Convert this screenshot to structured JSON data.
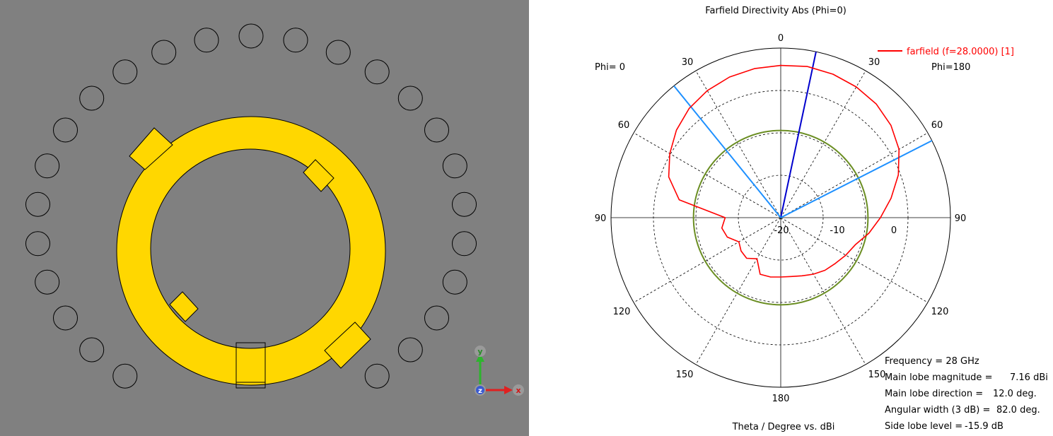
{
  "colors": {
    "viewport_bg": "#808080",
    "ring_fill": "#ffd700",
    "via_stroke": "#000000",
    "curve": "#ff0000",
    "reference_circle": "#6b8e23",
    "main_lobe": "#0000cd",
    "beamwidth": "#1e90ff"
  },
  "axes_widget": {
    "y_label": "y",
    "x_label": "x",
    "z_label": "z"
  },
  "plot": {
    "title": "Farfield Directivity Abs (Phi=0)",
    "phi_left": "Phi=  0",
    "phi_right": "Phi=180",
    "legend": "farfield (f=28.0000) [1]",
    "xlabel": "Theta / Degree vs. dBi",
    "angle_labels": {
      "top": "0",
      "left_30": "30",
      "right_30": "30",
      "left_60": "60",
      "right_60": "60",
      "left_90": "90",
      "right_90": "90",
      "left_120": "120",
      "right_120": "120",
      "left_150": "150",
      "right_150": "150",
      "bottom": "180"
    },
    "radial_labels": [
      "-20",
      "-10",
      "0"
    ]
  },
  "info": {
    "frequency_label": "Frequency = 28 GHz",
    "main_lobe_magnitude_label": "Main lobe magnitude =",
    "main_lobe_magnitude_value": "7.16 dBi",
    "main_lobe_direction_label": "Main lobe direction =",
    "main_lobe_direction_value": "12.0 deg.",
    "angular_width_label": "Angular width (3 dB) =",
    "angular_width_value": "82.0 deg.",
    "side_lobe_label": "Side lobe level =",
    "side_lobe_value": "-15.9 dB"
  },
  "chart_data": {
    "type": "line",
    "projection": "polar",
    "title": "Farfield Directivity Abs (Phi=0)",
    "xlabel": "Theta / Degree vs. dBi",
    "radial_ticks": [
      -20,
      -10,
      0
    ],
    "angle_ticks": [
      0,
      30,
      60,
      90,
      120,
      150,
      180
    ],
    "main_lobe_direction_deg": 12.0,
    "main_lobe_magnitude_dBi": 7.16,
    "angular_width_3dB_deg": 82.0,
    "side_lobe_level_dB": -15.9,
    "series": [
      {
        "name": "farfield (f=28.0000) [1]",
        "x": [
          0,
          10,
          20,
          30,
          40,
          50,
          60,
          70,
          80,
          90,
          100,
          110,
          120,
          130,
          140,
          150,
          160,
          170,
          180,
          -170,
          -160,
          -150,
          -140,
          -130,
          -120,
          -110,
          -100,
          -90,
          -80,
          -70,
          -60,
          -50,
          -40,
          -30,
          -20,
          -10
        ],
        "y": [
          5.9,
          6.2,
          6.0,
          5.6,
          5.0,
          3.9,
          2.2,
          -0.5,
          -3.6,
          -6.5,
          -8.9,
          -11.3,
          -12.3,
          -13.2,
          -13.8,
          -14.6,
          -15.4,
          -15.9,
          -16.0,
          -15.8,
          -15.8,
          -18.8,
          -17.5,
          -17.8,
          -18.6,
          -16.6,
          -15.9,
          -16.9,
          -5.7,
          -1.9,
          0.2,
          2.1,
          3.6,
          4.6,
          5.3,
          5.7
        ]
      }
    ]
  }
}
